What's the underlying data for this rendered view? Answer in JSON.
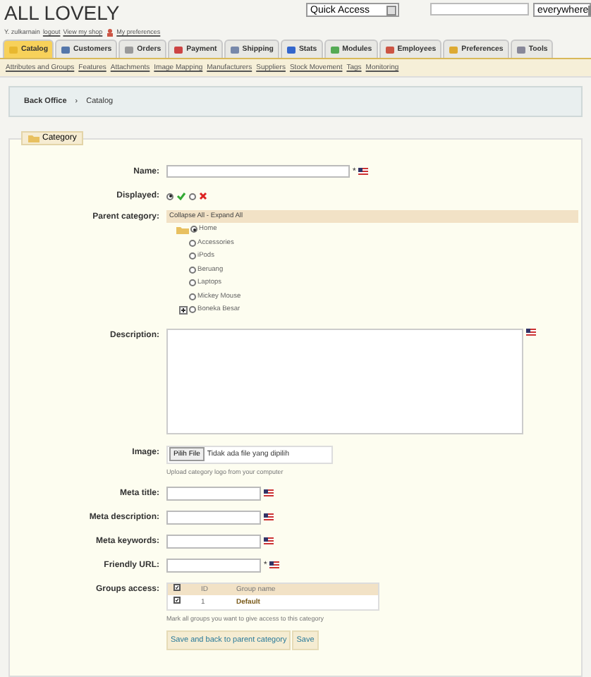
{
  "header": {
    "title": "ALL LOVELY",
    "quick_access": "Quick Access",
    "search_scope": "everywhere",
    "user": "Y. zulkarnain",
    "logout": "logout",
    "view_shop": "View my shop",
    "preferences": "My preferences"
  },
  "tabs": [
    {
      "label": "Catalog",
      "selected": true
    },
    {
      "label": "Customers",
      "selected": false
    },
    {
      "label": "Orders",
      "selected": false
    },
    {
      "label": "Payment",
      "selected": false
    },
    {
      "label": "Shipping",
      "selected": false
    },
    {
      "label": "Stats",
      "selected": false
    },
    {
      "label": "Modules",
      "selected": false
    },
    {
      "label": "Employees",
      "selected": false
    },
    {
      "label": "Preferences",
      "selected": false
    },
    {
      "label": "Tools",
      "selected": false
    }
  ],
  "subtabs": [
    "Attributes and Groups",
    "Features",
    "Attachments",
    "Image Mapping",
    "Manufacturers",
    "Suppliers",
    "Stock Movement",
    "Tags",
    "Monitoring"
  ],
  "breadcrumb": {
    "items": [
      "Back Office",
      "Catalog"
    ],
    "separator": "›"
  },
  "form": {
    "legend": "Category",
    "name": {
      "label": "Name:",
      "required_mark": "*"
    },
    "displayed": {
      "label": "Displayed:",
      "options": [
        {
          "kind": "yes",
          "selected": true
        },
        {
          "kind": "no",
          "selected": false
        }
      ]
    },
    "parent": {
      "label": "Parent category:",
      "collapse": "Collapse All",
      "separator": "-",
      "expand": "Expand All",
      "tree": [
        {
          "label": "Home",
          "selected": true,
          "collapsed": false,
          "children": [
            {
              "label": "Accessories",
              "selected": false,
              "collapsed": false
            },
            {
              "label": "iPods",
              "selected": false,
              "collapsed": false
            },
            {
              "label": "Beruang",
              "selected": false,
              "collapsed": false
            },
            {
              "label": "Laptops",
              "selected": false,
              "collapsed": false
            },
            {
              "label": "Mickey Mouse",
              "selected": false,
              "collapsed": false
            },
            {
              "label": "Boneka Besar",
              "selected": false,
              "collapsed": true
            }
          ]
        }
      ]
    },
    "description": {
      "label": "Description:"
    },
    "image": {
      "label": "Image:",
      "button": "Pilih File",
      "status": "Tidak ada file yang dipilih",
      "hint": "Upload category logo from your computer"
    },
    "meta": [
      {
        "label": "Meta title:"
      },
      {
        "label": "Meta description:"
      },
      {
        "label": "Meta keywords:"
      },
      {
        "label": "Friendly URL:",
        "required_mark": "*"
      }
    ],
    "groups": {
      "label": "Groups access:",
      "all_checked": true,
      "columns": [
        "ID",
        "Group name"
      ],
      "rows": [
        {
          "checked": true,
          "id": "1",
          "name": "Default"
        }
      ],
      "hint": "Mark all groups you want to give access to this category"
    },
    "buttons": [
      "Save and back to parent category",
      "Save"
    ]
  }
}
